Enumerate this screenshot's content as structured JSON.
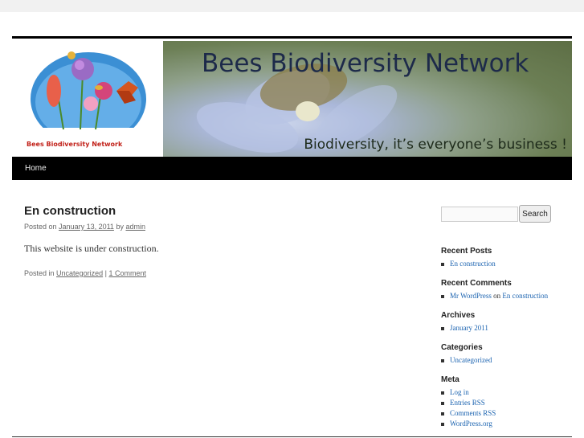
{
  "header": {
    "site_title": "Bees Biodiversity Network",
    "tagline": "Biodiversity, it’s everyone’s business !",
    "logo_text": "Bees Biodiversity Network"
  },
  "nav": {
    "home": "Home"
  },
  "post": {
    "title": "En construction",
    "posted_on": "Posted on",
    "date": "January 13, 2011",
    "by": "by",
    "author": "admin",
    "content": "This website is under construction.",
    "posted_in": "Posted in",
    "category": "Uncategorized",
    "separator": "|",
    "comments": "1 Comment"
  },
  "sidebar": {
    "search_placeholder": "",
    "search_button": "Search",
    "recent_posts": {
      "title": "Recent Posts",
      "items": [
        "En construction"
      ]
    },
    "recent_comments": {
      "title": "Recent Comments",
      "author": "Mr WordPress",
      "on": "on",
      "post": "En construction"
    },
    "archives": {
      "title": "Archives",
      "items": [
        "January 2011"
      ]
    },
    "categories": {
      "title": "Categories",
      "items": [
        "Uncategorized"
      ]
    },
    "meta": {
      "title": "Meta",
      "items": [
        "Log in",
        "Entries RSS",
        "Comments RSS",
        "WordPress.org"
      ]
    }
  },
  "colors": {
    "link": "#1b63b0",
    "nav_bg": "#000000",
    "page_bg": "#f1f1f1"
  }
}
